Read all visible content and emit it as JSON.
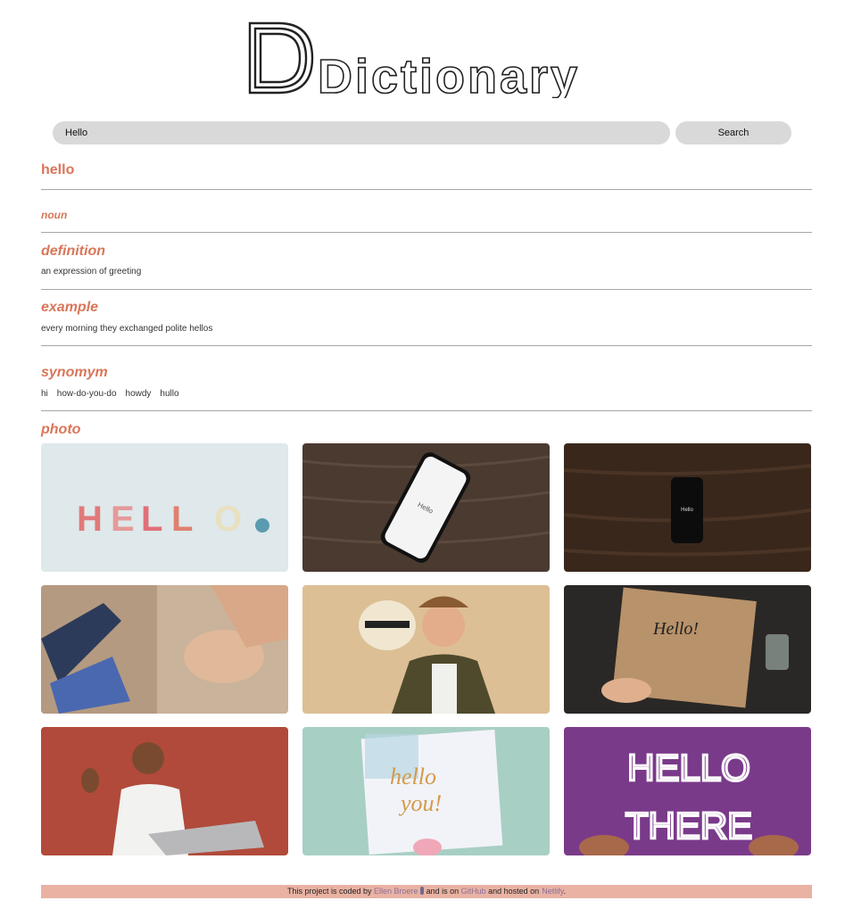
{
  "app": {
    "logo_text": "Dictionary"
  },
  "search": {
    "value": "Hello",
    "button_label": "Search"
  },
  "entry": {
    "word": "hello",
    "part_of_speech": "noun",
    "definition_heading": "definition",
    "definition": "an expression of greeting",
    "example_heading": "example",
    "example": "every morning they exchanged polite hellos",
    "synonym_heading": "synomym",
    "synonyms": [
      "hi",
      "how-do-you-do",
      "howdy",
      "hullo"
    ],
    "photo_heading": "photo"
  },
  "photos": [
    {
      "subject": "HELLO letters"
    },
    {
      "subject": "Hello phone"
    },
    {
      "subject": "Hello phone dark"
    },
    {
      "subject": "handshake"
    },
    {
      "subject": "man with hat"
    },
    {
      "subject": "Hello lettering"
    },
    {
      "subject": "man waving at laptop"
    },
    {
      "subject": "hello you card"
    },
    {
      "subject": "HELLO THERE neon"
    }
  ],
  "photo_text": {
    "hello_blocks": [
      "H",
      "E",
      "L",
      "L",
      "O"
    ],
    "phone_screen": "Hello",
    "lettering": "Hello!",
    "card_line1": "hello",
    "card_line2": "you!",
    "neon_line1": "HELLO",
    "neon_line2": "THERE"
  },
  "footer": {
    "prefix": "This project is coded by",
    "author": "Ellen Broere",
    "middle": "and is on",
    "repo": "GitHub",
    "hosted": "and hosted on",
    "host": "Netlify",
    "suffix": "."
  },
  "colors": {
    "accent": "#d9765a",
    "footer_bg": "#e9b2a3",
    "link": "#8a6f9a",
    "input_bg": "#d9d9d9"
  }
}
